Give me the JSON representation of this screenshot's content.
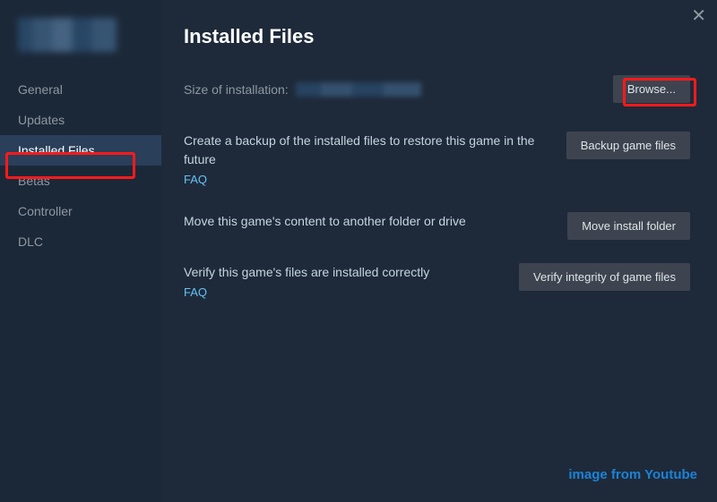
{
  "sidebar": {
    "items": [
      {
        "label": "General"
      },
      {
        "label": "Updates"
      },
      {
        "label": "Installed Files"
      },
      {
        "label": "Betas"
      },
      {
        "label": "Controller"
      },
      {
        "label": "DLC"
      }
    ],
    "active_index": 2
  },
  "main": {
    "title": "Installed Files",
    "close_symbol": "✕",
    "size_label": "Size of installation:",
    "browse_label": "Browse...",
    "rows": [
      {
        "desc": "Create a backup of the installed files to restore this game in the future",
        "faq": "FAQ",
        "button": "Backup game files"
      },
      {
        "desc": "Move this game's content to another folder or drive",
        "faq": null,
        "button": "Move install folder"
      },
      {
        "desc": "Verify this game's files are installed correctly",
        "faq": "FAQ",
        "button": "Verify integrity of game files"
      }
    ]
  },
  "attribution": "image from Youtube",
  "highlights": {
    "installed_files_sidebar": true,
    "browse_button": true
  }
}
